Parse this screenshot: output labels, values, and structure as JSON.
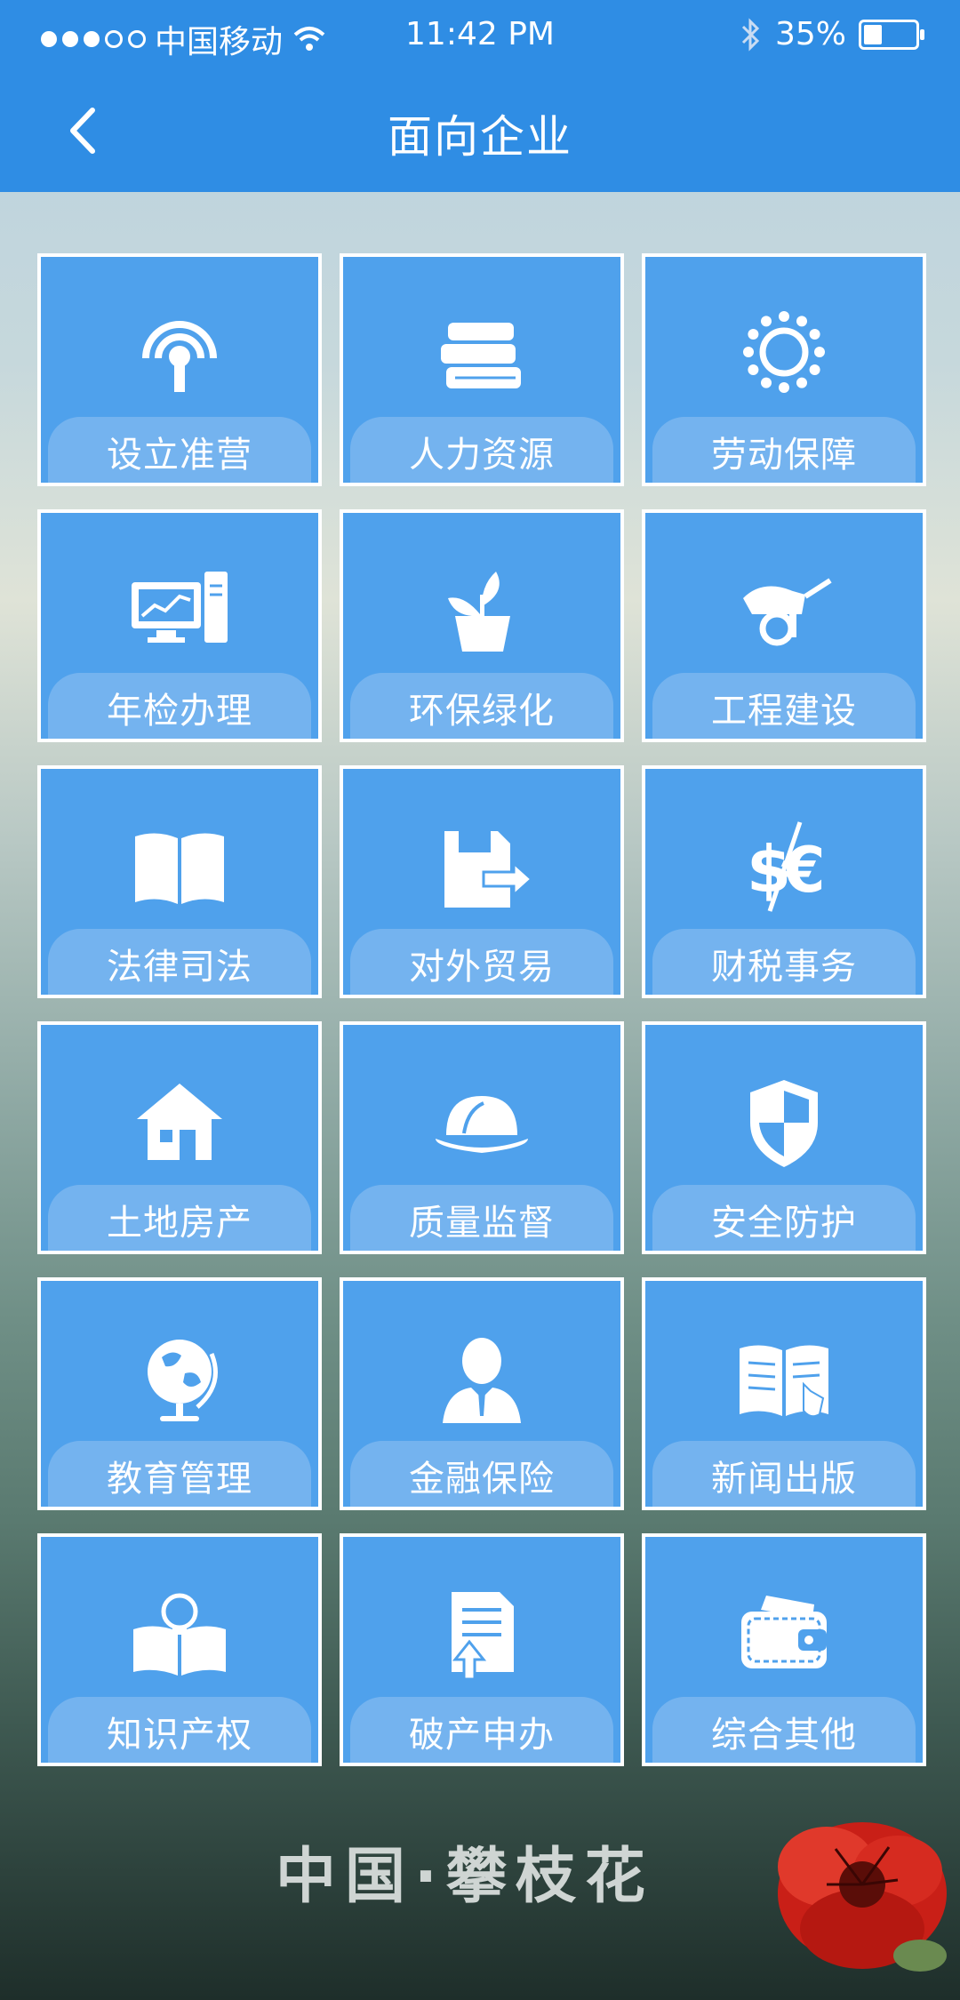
{
  "status": {
    "carrier": "中国移动",
    "time": "11:42 PM",
    "battery": "35%",
    "signal_dots": {
      "filled": 3,
      "empty": 2
    },
    "battery_level": 0.35
  },
  "nav": {
    "title": "面向企业"
  },
  "tiles": [
    {
      "label": "设立准营",
      "icon": "signal-broadcast-icon"
    },
    {
      "label": "人力资源",
      "icon": "books-icon"
    },
    {
      "label": "劳动保障",
      "icon": "sun-icon"
    },
    {
      "label": "年检办理",
      "icon": "computer-chart-icon"
    },
    {
      "label": "环保绿化",
      "icon": "potted-plant-icon"
    },
    {
      "label": "工程建设",
      "icon": "wheelbarrow-icon"
    },
    {
      "label": "法律司法",
      "icon": "open-book-icon"
    },
    {
      "label": "对外贸易",
      "icon": "export-arrow-icon"
    },
    {
      "label": "财税事务",
      "icon": "currency-icon"
    },
    {
      "label": "土地房产",
      "icon": "house-icon"
    },
    {
      "label": "质量监督",
      "icon": "hard-hat-icon"
    },
    {
      "label": "安全防护",
      "icon": "shield-icon"
    },
    {
      "label": "教育管理",
      "icon": "globe-icon"
    },
    {
      "label": "金融保险",
      "icon": "businessman-icon"
    },
    {
      "label": "新闻出版",
      "icon": "reading-book-icon"
    },
    {
      "label": "知识产权",
      "icon": "book-lightbulb-icon"
    },
    {
      "label": "破产申办",
      "icon": "document-upload-icon"
    },
    {
      "label": "综合其他",
      "icon": "wallet-icon"
    }
  ],
  "footer": {
    "text": "中国·攀枝花"
  },
  "colors": {
    "primary_blue": "#2f8de4",
    "tile_blue": "#4fa1ec",
    "label_band": "#74b3ef",
    "flower_red": "#d8261b"
  }
}
